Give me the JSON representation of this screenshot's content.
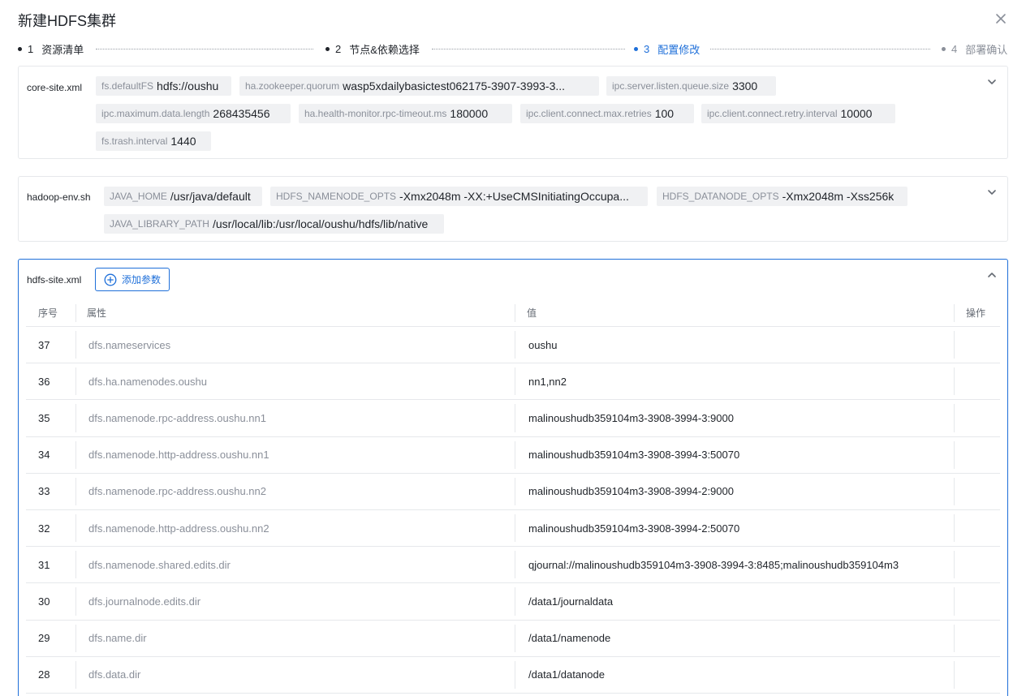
{
  "dialog": {
    "title": "新建HDFS集群"
  },
  "steps": [
    {
      "num": "1",
      "label": "资源清单"
    },
    {
      "num": "2",
      "label": "节点&依赖选择"
    },
    {
      "num": "3",
      "label": "配置修改"
    },
    {
      "num": "4",
      "label": "部署确认"
    }
  ],
  "core_site": {
    "label": "core-site.xml",
    "params": [
      {
        "key": "fs.defaultFS",
        "value": "hdfs://oushu"
      },
      {
        "key": "ha.zookeeper.quorum",
        "value": "wasp5xdailybasictest062175-3907-3993-3..."
      },
      {
        "key": "ipc.server.listen.queue.size",
        "value": "3300"
      },
      {
        "key": "ipc.maximum.data.length",
        "value": "268435456"
      },
      {
        "key": "ha.health-monitor.rpc-timeout.ms",
        "value": "180000"
      },
      {
        "key": "ipc.client.connect.max.retries",
        "value": "100"
      },
      {
        "key": "ipc.client.connect.retry.interval",
        "value": "10000"
      },
      {
        "key": "fs.trash.interval",
        "value": "1440"
      }
    ]
  },
  "hadoop_env": {
    "label": "hadoop-env.sh",
    "params": [
      {
        "key": "JAVA_HOME",
        "value": "/usr/java/default"
      },
      {
        "key": "HDFS_NAMENODE_OPTS",
        "value": "-Xmx2048m -XX:+UseCMSInitiatingOccupa..."
      },
      {
        "key": "HDFS_DATANODE_OPTS",
        "value": "-Xmx2048m -Xss256k"
      },
      {
        "key": "JAVA_LIBRARY_PATH",
        "value": "/usr/local/lib:/usr/local/oushu/hdfs/lib/native"
      }
    ]
  },
  "hdfs_site": {
    "label": "hdfs-site.xml",
    "add_label": "添加参数",
    "columns": {
      "no": "序号",
      "key": "属性",
      "value": "值",
      "ops": "操作"
    },
    "rows": [
      {
        "no": "37",
        "key": "dfs.nameservices",
        "value": "oushu"
      },
      {
        "no": "36",
        "key": "dfs.ha.namenodes.oushu",
        "value": "nn1,nn2"
      },
      {
        "no": "35",
        "key": "dfs.namenode.rpc-address.oushu.nn1",
        "value": "malinoushudb359104m3-3908-3994-3:9000"
      },
      {
        "no": "34",
        "key": "dfs.namenode.http-address.oushu.nn1",
        "value": "malinoushudb359104m3-3908-3994-3:50070"
      },
      {
        "no": "33",
        "key": "dfs.namenode.rpc-address.oushu.nn2",
        "value": "malinoushudb359104m3-3908-3994-2:9000"
      },
      {
        "no": "32",
        "key": "dfs.namenode.http-address.oushu.nn2",
        "value": "malinoushudb359104m3-3908-3994-2:50070"
      },
      {
        "no": "31",
        "key": "dfs.namenode.shared.edits.dir",
        "value": "qjournal://malinoushudb359104m3-3908-3994-3:8485;malinoushudb359104m3"
      },
      {
        "no": "30",
        "key": "dfs.journalnode.edits.dir",
        "value": "/data1/journaldata"
      },
      {
        "no": "29",
        "key": "dfs.name.dir",
        "value": "/data1/namenode"
      },
      {
        "no": "28",
        "key": "dfs.data.dir",
        "value": "/data1/datanode"
      }
    ]
  },
  "colors": {
    "accent": "#1e6fd9",
    "border": "#e6e8eb",
    "tag_bg": "#f0f1f3"
  },
  "icons": {
    "close": "close-icon",
    "collapse": "chevron-up-icon",
    "expand": "chevron-down-icon",
    "add": "plus-circle-icon"
  }
}
